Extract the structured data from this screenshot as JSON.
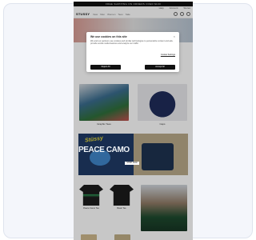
{
  "site": {
    "promo_text": "FREE SHIPPING ON ORDERS OVER $100",
    "util_links": [
      "Help",
      "Account",
      "Stores"
    ],
    "logo": "STUSSY",
    "nav": [
      "New",
      "Men",
      "Women",
      "Tees",
      "Sale"
    ]
  },
  "cookie_modal": {
    "title": "We use cookies on this site",
    "body": "We and our partners use cookies and similar technologies to personalize content and ads, provide social media features and analyze our traffic.",
    "settings_link": "Cookie Settings",
    "reject_label": "Reject All",
    "accept_label": "Accept All"
  },
  "products_row1": [
    {
      "label": "Graphic Tees"
    },
    {
      "label": "Caps"
    }
  ],
  "banner": {
    "tag": "Stüssy",
    "headline": "PEACE CAMO",
    "cta": "SHOP NOW"
  },
  "products_row2": [
    {
      "label": "Peace Camo Tee"
    },
    {
      "label": "Basic Tee"
    }
  ]
}
